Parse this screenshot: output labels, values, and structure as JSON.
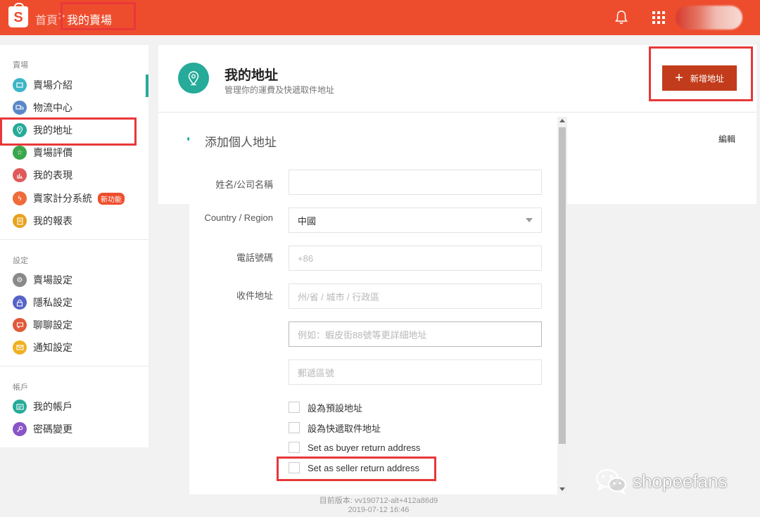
{
  "topbar": {
    "home": "首頁",
    "separator": ">",
    "current": "我的賣場",
    "logo_letter": "S"
  },
  "sidebar": {
    "sections": [
      {
        "title": "賣場",
        "items": [
          {
            "label": "賣場介紹",
            "icon": "store-icon",
            "color": "#3cb5c8"
          },
          {
            "label": "物流中心",
            "icon": "truck-icon",
            "color": "#5a87c8"
          },
          {
            "label": "我的地址",
            "icon": "pin-icon",
            "color": "#26aa99",
            "active": true
          },
          {
            "label": "賣場評價",
            "icon": "star-icon",
            "color": "#3aa64a"
          },
          {
            "label": "我的表現",
            "icon": "chart-icon",
            "color": "#e05a5a"
          },
          {
            "label": "賣家計分系統",
            "icon": "score-icon",
            "color": "#ee6b3a",
            "badge": "新功能"
          },
          {
            "label": "我的報表",
            "icon": "report-icon",
            "color": "#e8a21e"
          }
        ]
      },
      {
        "title": "設定",
        "items": [
          {
            "label": "賣場設定",
            "icon": "gear-icon",
            "color": "#8a8a8a"
          },
          {
            "label": "隱私設定",
            "icon": "lock-icon",
            "color": "#5563c8"
          },
          {
            "label": "聊聊設定",
            "icon": "chat-icon",
            "color": "#e05a3a"
          },
          {
            "label": "通知設定",
            "icon": "bell-icon",
            "color": "#f0b021"
          }
        ]
      },
      {
        "title": "帳戶",
        "items": [
          {
            "label": "我的帳戶",
            "icon": "account-icon",
            "color": "#26aa99"
          },
          {
            "label": "密碼變更",
            "icon": "key-icon",
            "color": "#8a55c8"
          }
        ]
      }
    ]
  },
  "main": {
    "title": "我的地址",
    "subtitle": "管理你的運費及快遞取件地址",
    "add_button": "新增地址",
    "edit": "編輯"
  },
  "modal": {
    "title": "添加個人地址",
    "fields": {
      "name_label": "姓名/公司名稱",
      "name_value": "",
      "country_label": "Country / Region",
      "country_value": "中國",
      "phone_label": "電話號碼",
      "phone_placeholder": "+86",
      "address_label": "收件地址",
      "region_placeholder": "州/省 / 城市 / 行政區",
      "detail_placeholder": "例如：蝦皮街88號等更詳細地址",
      "zip_placeholder": "郵遞區號"
    },
    "checkboxes": [
      "設為預設地址",
      "設為快遞取件地址",
      "Set as buyer return address",
      "Set as seller return address"
    ]
  },
  "footer": {
    "version_line1": "目前版本: vv190712-alt+412a86d9",
    "version_line2": "2019-07-12 16:46"
  },
  "watermark": {
    "text": "shopeefans"
  }
}
